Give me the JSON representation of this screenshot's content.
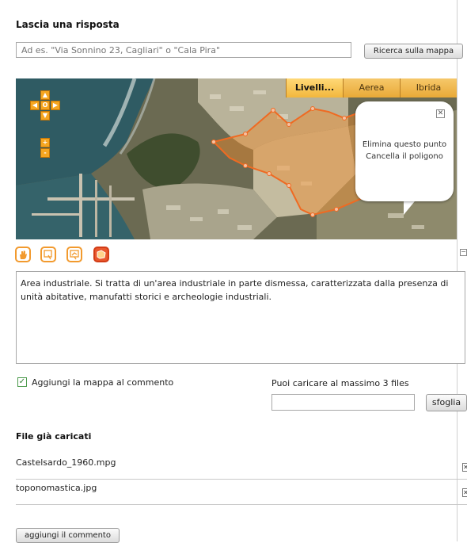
{
  "form": {
    "title": "Lascia una risposta",
    "search_placeholder": "Ad es. \"Via Sonnino 23, Cagliari\" o \"Cala Pira\"",
    "search_button": "Ricerca sulla mappa"
  },
  "map": {
    "tabs": [
      {
        "label": "Livelli...",
        "active": true
      },
      {
        "label": "Aerea",
        "active": false
      },
      {
        "label": "Ibrida",
        "active": false
      }
    ],
    "nav": {
      "up": "▲",
      "left": "◀",
      "center": "O",
      "right": "▶",
      "down": "▼",
      "zoom_in": "+",
      "zoom_out": "-"
    },
    "popup": {
      "close": "✕",
      "line1": "Elimina questo punto",
      "line2": "Cancella il poligono"
    },
    "polygon_color": "#f08a2a"
  },
  "tools": [
    "hand-icon",
    "point-icon",
    "line-icon",
    "polygon-icon"
  ],
  "collapse_glyph": "−",
  "comment_text": "Area industriale. Si tratta di un'area industriale in parte dismessa, caratterizzata dalla presenza di unità abitative, manufatti storici e archeologie industriali.",
  "attach_map": {
    "label": "Aggiungi la mappa al commento",
    "checked": true,
    "glyph": "✓"
  },
  "upload": {
    "label": "Puoi caricare al massimo 3 files",
    "browse_button": "sfoglia"
  },
  "files": {
    "heading": "File già caricati",
    "items": [
      {
        "name": "Castelsardo_1960.mpg",
        "delete": "✕"
      },
      {
        "name": "toponomastica.jpg",
        "delete": "✕"
      }
    ]
  },
  "submit_button": "aggiungi il commento",
  "colors": {
    "accent_orange": "#f6a620",
    "active_tool": "#e9572c"
  }
}
